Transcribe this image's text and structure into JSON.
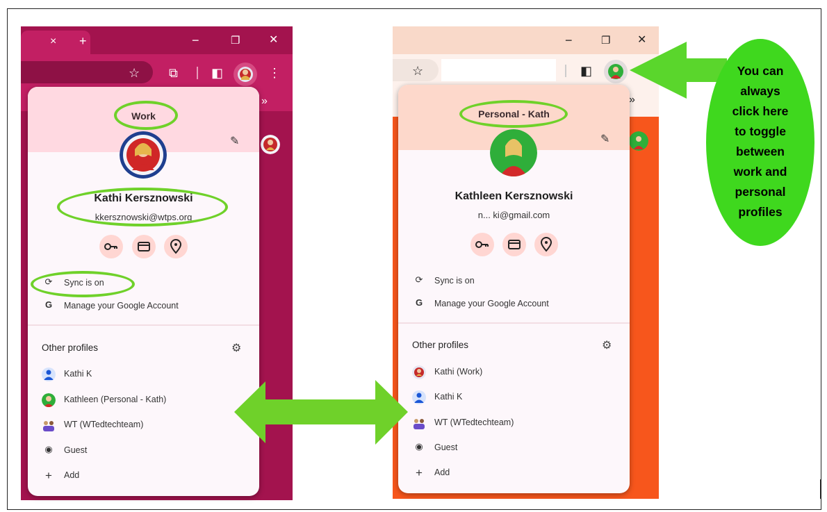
{
  "annotation": {
    "callout_lines": [
      "You can",
      "always",
      "click here",
      "to toggle",
      "between",
      "work and",
      "personal",
      "profiles"
    ]
  },
  "colors": {
    "work_frame": "#a3134e",
    "personal_frame": "#f7561c",
    "highlight": "#6fd12a",
    "callout": "#3fd81e"
  },
  "left_window": {
    "titlebar_glyphs": {
      "close": "×",
      "new_tab": "+",
      "minimize": "−",
      "restore": "❐",
      "close_window": "✕"
    },
    "toolbar_glyphs": {
      "star": "☆",
      "extensions": "⧉",
      "side_panel": "◧",
      "menu": "⋮"
    },
    "bookmark_overflow": "»",
    "profile": {
      "title": "Work",
      "name": "Kathi Kersznowski",
      "email": "kkersznowski@wtps.org",
      "sync": "Sync is on",
      "manage": "Manage your Google Account",
      "other_title": "Other profiles",
      "others": [
        "Kathi K",
        "Kathleen (Personal - Kath)",
        "WT (WTedtechteam)",
        "Guest"
      ],
      "add": "Add"
    }
  },
  "right_window": {
    "titlebar_glyphs": {
      "minimize": "−",
      "restore": "❐",
      "close_window": "✕"
    },
    "toolbar_glyphs": {
      "star": "☆",
      "side_panel": "◧"
    },
    "bookmark_overflow": "»",
    "profile": {
      "title": "Personal - Kath",
      "name": "Kathleen Kersznowski",
      "email": "n... ki@gmail.com",
      "sync": "Sync is on",
      "manage": "Manage your Google Account",
      "other_title": "Other profiles",
      "others": [
        "Kathi (Work)",
        "Kathi K",
        "WT (WTedtechteam)",
        "Guest"
      ],
      "add": "Add"
    }
  },
  "icons": {
    "chips": [
      "key-icon",
      "card-icon",
      "location-pin-icon"
    ],
    "sync": "sync-icon",
    "google": "google-g-icon",
    "edit": "pencil-icon",
    "settings": "gear-icon"
  }
}
